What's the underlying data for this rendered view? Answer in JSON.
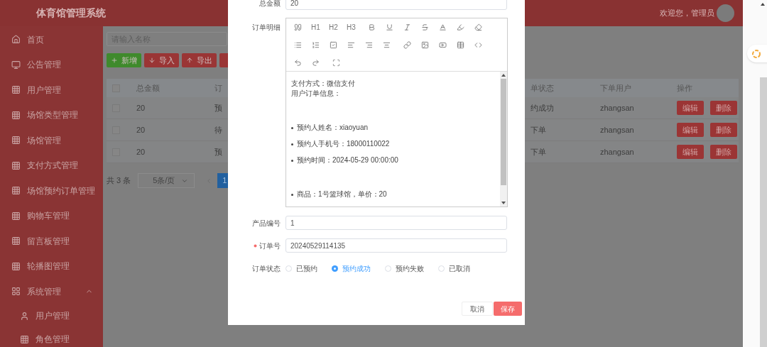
{
  "header": {
    "title": "体育馆管理系统",
    "welcome": "欢迎您，管理员"
  },
  "sidebar": {
    "items": [
      {
        "label": "首页"
      },
      {
        "label": "公告管理"
      },
      {
        "label": "用户管理"
      },
      {
        "label": "场馆类型管理"
      },
      {
        "label": "场馆管理"
      },
      {
        "label": "支付方式管理"
      },
      {
        "label": "场馆预约订单管理"
      },
      {
        "label": "购物车管理"
      },
      {
        "label": "留言板管理"
      },
      {
        "label": "轮播图管理"
      },
      {
        "label": "系统管理",
        "expanded": true,
        "children": [
          {
            "label": "用户管理"
          },
          {
            "label": "角色管理"
          }
        ]
      }
    ]
  },
  "toolbar": {
    "search": {
      "placeholder": "请输入名称"
    },
    "buttons": [
      {
        "label": "新增",
        "kind": "add"
      },
      {
        "label": "导入",
        "kind": "import"
      },
      {
        "label": "导出",
        "kind": "export"
      },
      {
        "kind": "partial"
      }
    ]
  },
  "table": {
    "all_checked": false,
    "columns": [
      "总金额",
      "订",
      "单状态",
      "下单用户",
      "操作"
    ],
    "rows": [
      {
        "checked": false,
        "cells": [
          "20",
          "预",
          "约成功",
          "zhangsan"
        ],
        "actions": [
          "编辑",
          "删除"
        ]
      },
      {
        "checked": false,
        "cells": [
          "20",
          "待",
          "下单",
          "zhangsan"
        ],
        "actions": [
          "编辑",
          "删除"
        ]
      },
      {
        "checked": false,
        "cells": [
          "20",
          "预",
          "下单",
          "zhangsan"
        ],
        "actions": [
          "编辑",
          "删除"
        ]
      }
    ]
  },
  "pagination": {
    "total": "共 3 条",
    "page_size": "5条/页",
    "pages": [
      {
        "label": "1",
        "selected": true
      }
    ]
  },
  "dialog": {
    "total_amount": {
      "label": "总金额",
      "value": "20"
    },
    "details": {
      "label": "订单明细",
      "heading_buttons": [
        "H1",
        "H2",
        "H3"
      ],
      "content": [
        {
          "kind": "text",
          "text": "支付方式：微信支付"
        },
        {
          "kind": "text",
          "text": "用户订单信息："
        },
        {
          "kind": "spacer"
        },
        {
          "kind": "bullet",
          "text": "预约人姓名：xiaoyuan"
        },
        {
          "kind": "bullet",
          "text": "预约人手机号：18000110022"
        },
        {
          "kind": "bullet",
          "text": "预约时间：2024-05-29 00:00:00"
        },
        {
          "kind": "spacer"
        },
        {
          "kind": "bullet",
          "text": "商品：1号篮球馆，单价：20"
        }
      ]
    },
    "product_no": {
      "label": "产品编号",
      "value": "1"
    },
    "order_no": {
      "label": "订单号",
      "value": "20240529114135",
      "required": true
    },
    "status": {
      "label": "订单状态",
      "options": [
        {
          "label": "已预约",
          "selected": false
        },
        {
          "label": "预约成功",
          "selected": true
        },
        {
          "label": "预约失败",
          "selected": false
        },
        {
          "label": "已取消",
          "selected": false
        }
      ]
    },
    "buttons": [
      {
        "label": "取消",
        "kind": "cancel"
      },
      {
        "label": "保存",
        "kind": "save"
      }
    ]
  }
}
